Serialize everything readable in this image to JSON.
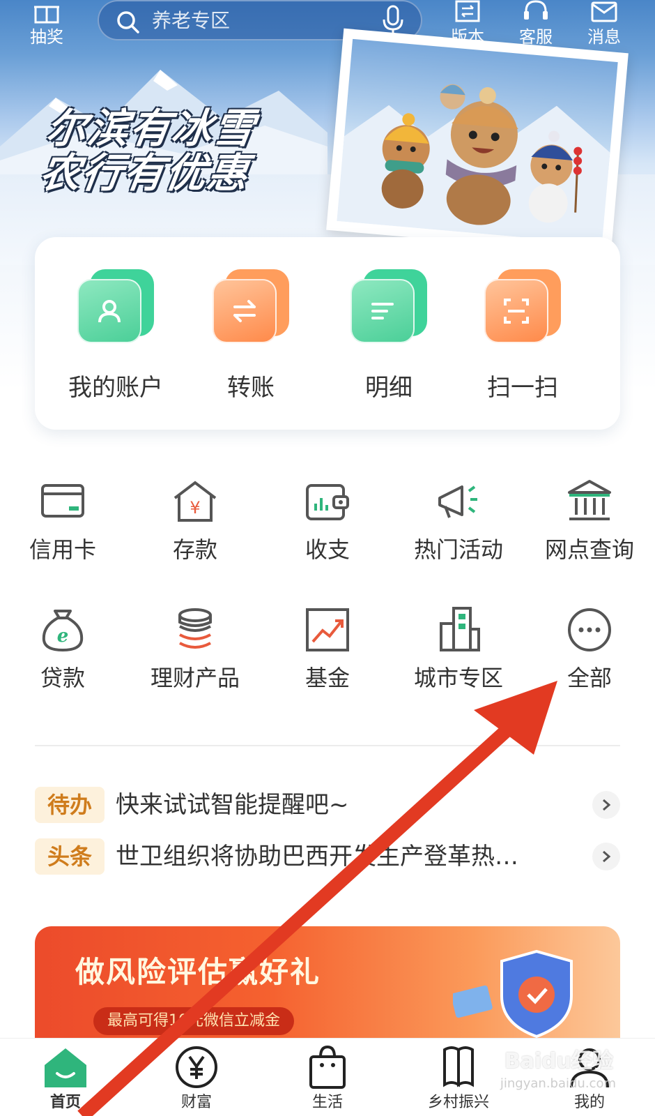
{
  "top_bar": {
    "lottery_label": "抽奖",
    "search_placeholder": "养老专区",
    "version_label": "版本",
    "service_label": "客服",
    "message_label": "消息"
  },
  "hero": {
    "slogan_line1": "尔滨有冰雪",
    "slogan_line2": "农行有优惠"
  },
  "quick_actions": [
    {
      "label": "我的账户",
      "icon": "user-card-icon",
      "color": "green"
    },
    {
      "label": "转账",
      "icon": "transfer-icon",
      "color": "orange"
    },
    {
      "label": "明细",
      "icon": "list-icon",
      "color": "green"
    },
    {
      "label": "扫一扫",
      "icon": "scan-icon",
      "color": "orange"
    }
  ],
  "grid": [
    {
      "label": "信用卡",
      "icon": "credit-card-icon"
    },
    {
      "label": "存款",
      "icon": "deposit-house-icon"
    },
    {
      "label": "收支",
      "icon": "wallet-chart-icon"
    },
    {
      "label": "热门活动",
      "icon": "megaphone-icon"
    },
    {
      "label": "网点查询",
      "icon": "bank-building-icon"
    },
    {
      "label": "贷款",
      "icon": "money-bag-icon"
    },
    {
      "label": "理财产品",
      "icon": "coin-stack-icon"
    },
    {
      "label": "基金",
      "icon": "trend-chart-icon"
    },
    {
      "label": "城市专区",
      "icon": "city-buildings-icon"
    },
    {
      "label": "全部",
      "icon": "more-dots-icon"
    }
  ],
  "notices": [
    {
      "tag": "待办",
      "text": "快来试试智能提醒吧~"
    },
    {
      "tag": "头条",
      "text": "世卫组织将协助巴西开发生产登革热…"
    }
  ],
  "promo": {
    "title": "做风险评估赢好礼",
    "subtitle": "最高可得10元微信立减金"
  },
  "bottom_nav": [
    {
      "label": "首页",
      "active": true
    },
    {
      "label": "财富",
      "active": false
    },
    {
      "label": "生活",
      "active": false
    },
    {
      "label": "乡村振兴",
      "active": false
    },
    {
      "label": "我的",
      "active": false
    }
  ],
  "watermark": {
    "brand": "Baidu经验",
    "url": "jingyan.baidu.com"
  },
  "colors": {
    "accent_green": "#2fb57c",
    "accent_orange": "#ff8a4a",
    "annotation_red": "#e23a22"
  }
}
